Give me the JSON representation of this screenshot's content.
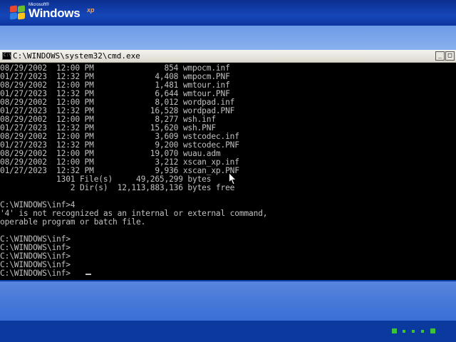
{
  "brand": {
    "microsoft": "Microsoft®",
    "windows": "Windows",
    "xp": "xp"
  },
  "window": {
    "title": "C:\\WINDOWS\\system32\\cmd.exe"
  },
  "console": {
    "lines": [
      "08/29/2002  12:00 PM               854 wmpocm.inf",
      "01/27/2023  12:32 PM             4,408 wmpocm.PNF",
      "08/29/2002  12:00 PM             1,481 wmtour.inf",
      "01/27/2023  12:32 PM             6,644 wmtour.PNF",
      "08/29/2002  12:00 PM             8,012 wordpad.inf",
      "01/27/2023  12:32 PM            16,528 wordpad.PNF",
      "08/29/2002  12:00 PM             8,277 wsh.inf",
      "01/27/2023  12:32 PM            15,620 wsh.PNF",
      "08/29/2002  12:00 PM             3,609 wstcodec.inf",
      "01/27/2023  12:32 PM             9,200 wstcodec.PNF",
      "08/29/2002  12:00 PM            19,070 wuau.adm",
      "08/29/2002  12:00 PM             3,212 xscan_xp.inf",
      "01/27/2023  12:32 PM             9,936 xscan_xp.PNF",
      "            1301 File(s)     49,265,299 bytes",
      "               2 Dir(s)  12,113,883,136 bytes free",
      "",
      "C:\\WINDOWS\\inf>4",
      "'4' is not recognized as an internal or external command,",
      "operable program or batch file.",
      "",
      "C:\\WINDOWS\\inf>",
      "C:\\WINDOWS\\inf>",
      "C:\\WINDOWS\\inf>",
      "C:\\WINDOWS\\inf>",
      "C:\\WINDOWS\\inf>"
    ]
  },
  "colors": {
    "console_bg": "#000000",
    "console_text": "#c0c0c0",
    "desktop_blue": "#0a3fa8"
  },
  "icons": {
    "app_icon": "cmd-icon",
    "minimize": "minimize-icon",
    "maximize": "maximize-icon",
    "pointer": "mouse-pointer-icon"
  }
}
